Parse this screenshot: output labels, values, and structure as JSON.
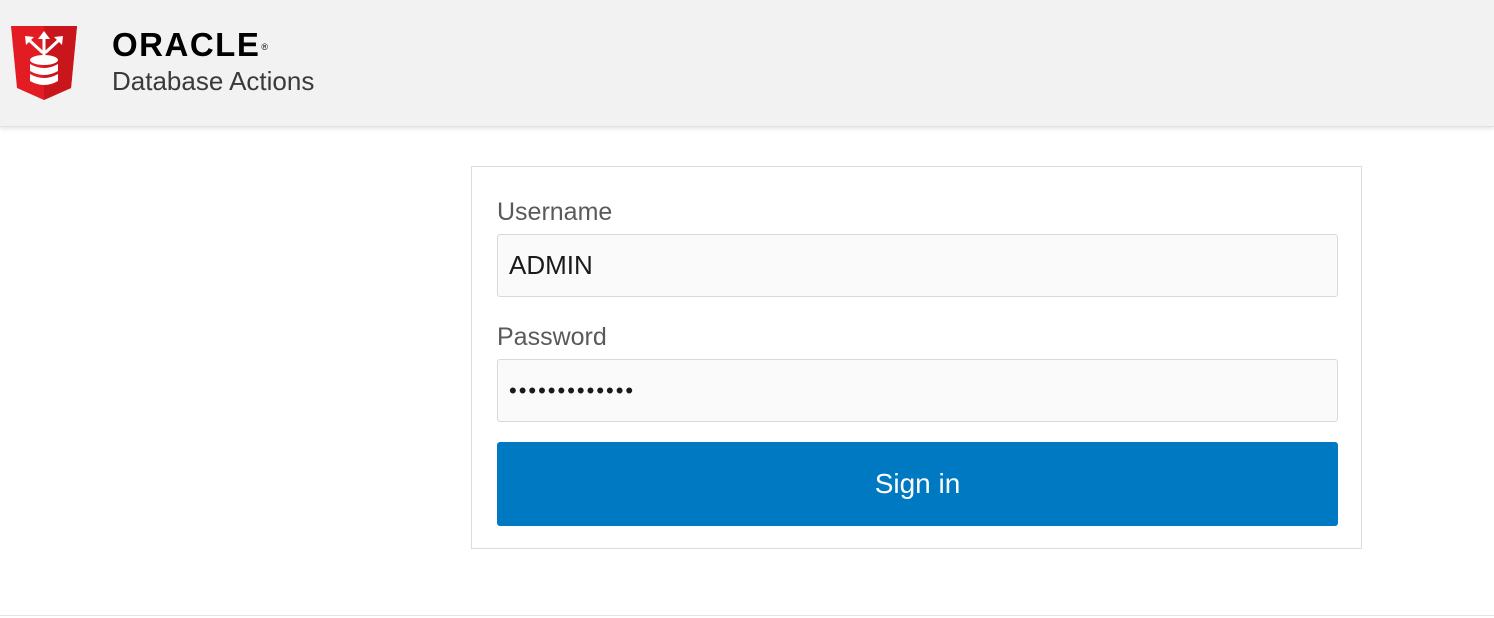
{
  "header": {
    "brand_wordmark": "ORACLE",
    "brand_registered": "®",
    "app_name": "Database Actions",
    "logo_icon": "oracle-database-shield-icon",
    "logo_color": "#e31b23"
  },
  "login": {
    "username_label": "Username",
    "username_value": "ADMIN",
    "password_label": "Password",
    "password_value": "•••••••••••••",
    "signin_label": "Sign in"
  },
  "colors": {
    "header_bg": "#f2f2f2",
    "primary_button": "#0079c3"
  }
}
